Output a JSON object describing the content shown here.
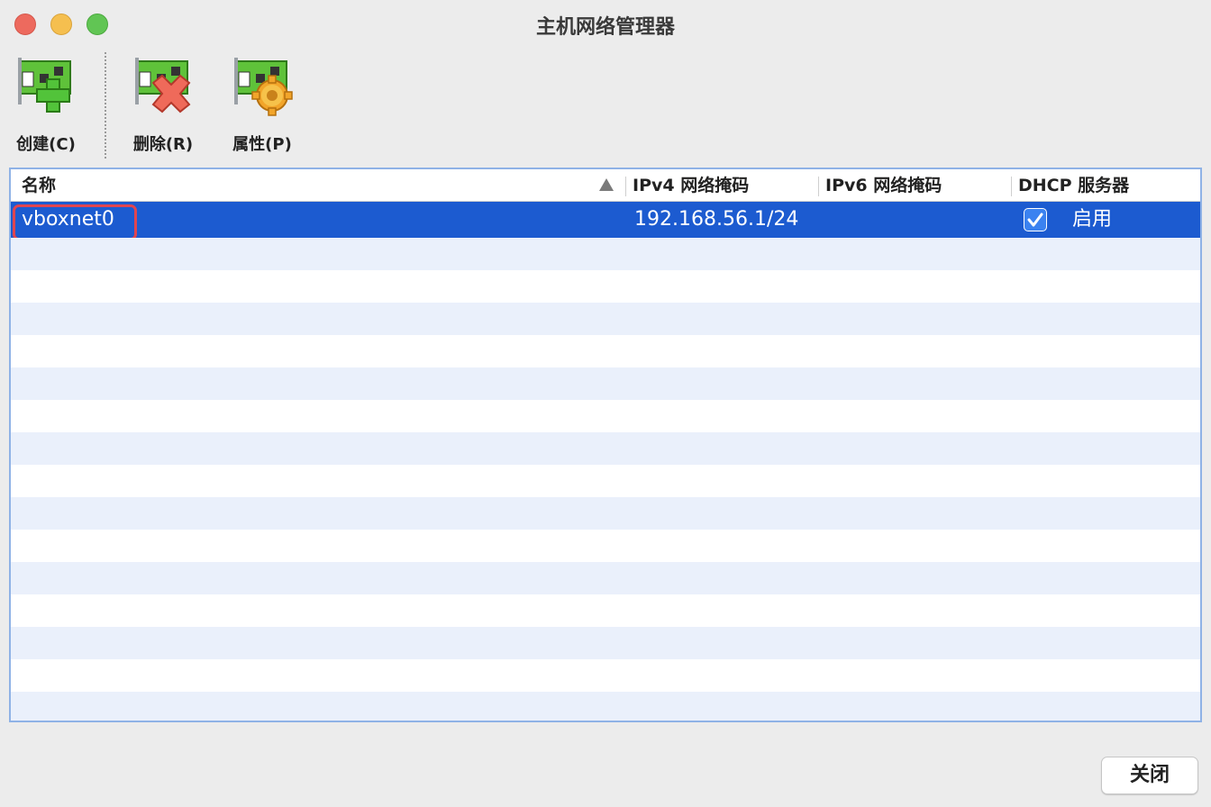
{
  "window": {
    "title": "主机网络管理器"
  },
  "toolbar": {
    "create_label": "创建(C)",
    "delete_label": "删除(R)",
    "properties_label": "属性(P)"
  },
  "table": {
    "columns": {
      "name": "名称",
      "ipv4": "IPv4 网络掩码",
      "ipv6": "IPv6 网络掩码",
      "dhcp": "DHCP 服务器"
    },
    "sort_column": "name",
    "rows": [
      {
        "name": "vboxnet0",
        "ipv4": "192.168.56.1/24",
        "ipv6": "",
        "dhcp_checked": true,
        "dhcp_label": "启用",
        "selected": true
      }
    ]
  },
  "footer": {
    "close_label": "关闭"
  },
  "colors": {
    "selection": "#1c5bd0",
    "highlight_outline": "#e0454f",
    "row_alt": "#eaf0fb"
  }
}
